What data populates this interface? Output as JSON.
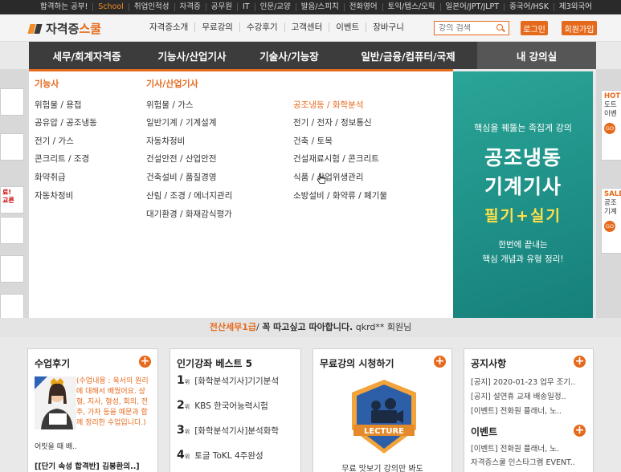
{
  "topbar": {
    "items": [
      "합격하는 공부!",
      "School",
      "취업인적성",
      "자격증",
      "공무원",
      "IT",
      "인문/교양",
      "발음/스피치",
      "전화영어",
      "토익/텝스/오픽",
      "일본어/JPT/JLPT",
      "중국어/HSK",
      "제3외국어"
    ]
  },
  "header": {
    "logo_a": "자격증",
    "logo_b": "스쿨",
    "nav": [
      "자격증소개",
      "무료강의",
      "수강후기",
      "고객센터",
      "이벤트",
      "장바구니"
    ],
    "search_placeholder": "강의 검색",
    "login": "로그인",
    "join": "회원가입"
  },
  "mainnav": [
    "세무/회계자격증",
    "기능사/산업기사",
    "기술사/기능장",
    "일반/금융/컴퓨터/국제",
    "내 강의실"
  ],
  "dropdown": {
    "col1_title": "기능사",
    "col1": [
      "위험물 / 용접",
      "공유압 / 공조냉동",
      "전기 / 가스",
      "콘크리트 / 조경",
      "화약취급",
      "자동차정비"
    ],
    "col2_title": "기사/산업기사",
    "col2": [
      "위험물 / 가스",
      "일반기계 / 기계설계",
      "자동차정비",
      "건설안전 / 산업안전",
      "건축설비 / 품질경영",
      "산림 / 조경 / 에너지관리",
      "대기환경 / 화재감식평가"
    ],
    "col3": [
      "공조냉동 / 화학분석",
      "전기 / 전자 / 정보통신",
      "건축 / 토목",
      "건설재료시험 / 콘크리트",
      "식품 / 산업위생관리",
      "소방설비 / 화약류 / 폐기물"
    ]
  },
  "promo": {
    "line1": "핵심을 꿰뚫는 족집게 강의",
    "line2": "공조냉동",
    "line3": "기계기사",
    "line4": "필기+실기",
    "line5": "한번에 끝내는",
    "line6": "핵심 개념과 유형 정리!"
  },
  "left_strip": {
    "text1": "료!",
    "text2": "교른"
  },
  "right_strip": {
    "card1_title": "HOT",
    "card1_l1": "도트",
    "card1_l2": "이벤",
    "card2_title": "SALE",
    "card2_l1": "공조",
    "card2_l2": "기계",
    "go": "GO"
  },
  "ticker": {
    "name": "전산세무1급",
    "text": "꼭 따고싶고 따아합니다.",
    "user": "qkrd** 회원님"
  },
  "review": {
    "title": "수업후기",
    "text": "(수업내용 : 육서의 원리에 대해서 배웠어요. 상형, 지사, 형성, 회의, 전주, 가차 등을 예문과 함께 정리한 수업입니다.)",
    "more": "어릿을 때 배..",
    "link": "[[단기 속성 합격반] 김봉환의..]"
  },
  "best": {
    "title": "인기강좌 베스트 5",
    "rank_suffix": "위",
    "items": [
      {
        "rank": "1",
        "label": "[화학분석기사]기기분석"
      },
      {
        "rank": "2",
        "label": "KBS 한국어능력시험"
      },
      {
        "rank": "3",
        "label": "[화학분석기사]분석화학"
      },
      {
        "rank": "4",
        "label": "토글 ToKL 4주완성"
      }
    ]
  },
  "free": {
    "title": "무료강의 시청하기",
    "badge": "LECTURE",
    "caption": "무료 맛보기 강의만 봐도"
  },
  "notice": {
    "title": "공지사항",
    "items": [
      "[공지] 2020-01-23 업무 조기..",
      "[공지] 설연휴 교재 배송일정..",
      "[이벤트] 전화원 플래너, 노.."
    ],
    "event_title": "이벤트",
    "events": [
      "[이벤트] 전화원 플래너, 노.",
      "자격증스쿨 인스타그램 EVENT.."
    ]
  }
}
